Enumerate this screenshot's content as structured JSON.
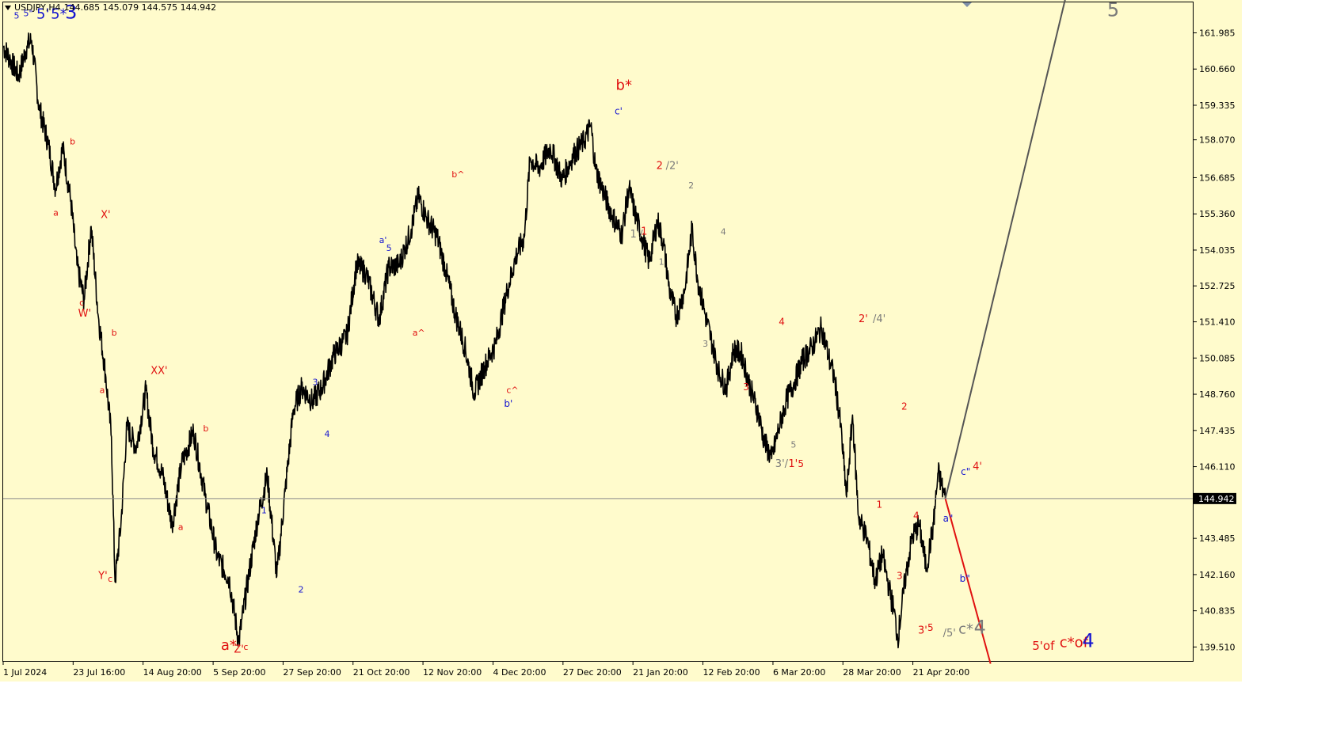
{
  "header": {
    "symbol_tf": "USDJPY,H4",
    "ohlc": "144.685 145.079 144.575 144.942"
  },
  "colors": {
    "background": "#fffbcc",
    "candles": "#000000",
    "red_label": "#e01010",
    "blue_label": "#1515d0",
    "gray_label": "#7a7a7a",
    "projection_up": "#555555",
    "projection_down": "#e01010"
  },
  "chart_data": {
    "type": "line",
    "symbol": "USDJPY",
    "timeframe": "H4",
    "last_price": 144.942,
    "ylim": [
      139.0,
      163.1
    ],
    "y_ticks": [
      161.985,
      160.66,
      159.335,
      158.07,
      156.685,
      155.36,
      154.035,
      152.725,
      151.41,
      150.085,
      148.76,
      147.435,
      146.11,
      144.942,
      143.485,
      142.16,
      140.835,
      139.51
    ],
    "x_ticks": [
      "1 Jul 2024",
      "23 Jul 16:00",
      "14 Aug 20:00",
      "5 Sep 20:00",
      "27 Sep 20:00",
      "21 Oct 20:00",
      "12 Nov 20:00",
      "4 Dec 20:00",
      "27 Dec 20:00",
      "21 Jan 20:00",
      "12 Feb 20:00",
      "6 Mar 20:00",
      "28 Mar 20:00",
      "21 Apr 20:00"
    ],
    "x_domain": [
      0,
      1000
    ],
    "x_tick_positions": [
      0,
      58.8,
      117.6,
      176.5,
      235.3,
      294.1,
      352.9,
      411.8,
      470.6,
      529.4,
      588.2,
      647.1,
      705.9,
      764.7
    ],
    "price_path": [
      [
        0,
        161.5
      ],
      [
        6,
        161.0
      ],
      [
        13,
        160.4
      ],
      [
        20,
        161.5
      ],
      [
        24,
        161.7
      ],
      [
        30,
        159.3
      ],
      [
        38,
        157.9
      ],
      [
        44,
        156.3
      ],
      [
        50,
        157.8
      ],
      [
        57,
        155.8
      ],
      [
        62,
        153.5
      ],
      [
        68,
        152.2
      ],
      [
        74,
        154.9
      ],
      [
        80,
        151.6
      ],
      [
        86,
        149.5
      ],
      [
        91,
        147.2
      ],
      [
        94,
        141.9
      ],
      [
        99,
        144.0
      ],
      [
        104,
        147.6
      ],
      [
        112,
        146.8
      ],
      [
        120,
        148.9
      ],
      [
        126,
        146.8
      ],
      [
        134,
        145.8
      ],
      [
        142,
        144.0
      ],
      [
        150,
        146.2
      ],
      [
        160,
        147.4
      ],
      [
        170,
        145.0
      ],
      [
        180,
        142.8
      ],
      [
        190,
        142.0
      ],
      [
        198,
        139.7
      ],
      [
        206,
        142.0
      ],
      [
        214,
        144.2
      ],
      [
        222,
        145.8
      ],
      [
        230,
        142.1
      ],
      [
        237,
        145.2
      ],
      [
        244,
        148.2
      ],
      [
        251,
        149.0
      ],
      [
        260,
        148.5
      ],
      [
        268,
        149.0
      ],
      [
        278,
        150.2
      ],
      [
        289,
        150.9
      ],
      [
        297,
        153.5
      ],
      [
        305,
        153.2
      ],
      [
        316,
        151.5
      ],
      [
        324,
        153.4
      ],
      [
        333,
        153.5
      ],
      [
        343,
        154.8
      ],
      [
        349,
        156.0
      ],
      [
        356,
        155.2
      ],
      [
        365,
        154.5
      ],
      [
        372,
        153.3
      ],
      [
        380,
        151.7
      ],
      [
        388,
        150.5
      ],
      [
        396,
        148.8
      ],
      [
        405,
        149.8
      ],
      [
        414,
        150.6
      ],
      [
        424,
        152.6
      ],
      [
        431,
        153.8
      ],
      [
        438,
        154.5
      ],
      [
        443,
        157.4
      ],
      [
        450,
        157.0
      ],
      [
        460,
        157.8
      ],
      [
        470,
        156.6
      ],
      [
        479,
        157.5
      ],
      [
        488,
        158.0
      ],
      [
        494,
        158.6
      ],
      [
        498,
        157.0
      ],
      [
        505,
        156.1
      ],
      [
        512,
        155.3
      ],
      [
        520,
        154.6
      ],
      [
        526,
        156.3
      ],
      [
        531,
        155.4
      ],
      [
        537,
        154.5
      ],
      [
        543,
        153.6
      ],
      [
        550,
        155.1
      ],
      [
        555,
        154.3
      ],
      [
        560,
        152.6
      ],
      [
        566,
        151.6
      ],
      [
        573,
        152.6
      ],
      [
        579,
        154.8
      ],
      [
        584,
        152.9
      ],
      [
        590,
        151.7
      ],
      [
        596,
        150.6
      ],
      [
        602,
        149.5
      ],
      [
        608,
        149.0
      ],
      [
        614,
        150.4
      ],
      [
        621,
        150.2
      ],
      [
        628,
        149.0
      ],
      [
        635,
        148.0
      ],
      [
        640,
        147.0
      ],
      [
        646,
        146.4
      ],
      [
        652,
        147.5
      ],
      [
        658,
        148.5
      ],
      [
        665,
        149.2
      ],
      [
        672,
        150.0
      ],
      [
        680,
        150.5
      ],
      [
        688,
        151.2
      ],
      [
        694,
        150.1
      ],
      [
        699,
        149.3
      ],
      [
        704,
        147.6
      ],
      [
        709,
        145.0
      ],
      [
        714,
        148.0
      ],
      [
        719,
        144.3
      ],
      [
        726,
        143.5
      ],
      [
        733,
        141.9
      ],
      [
        739,
        142.9
      ],
      [
        745,
        141.6
      ],
      [
        749,
        140.8
      ],
      [
        752,
        139.8
      ],
      [
        758,
        141.9
      ],
      [
        764,
        143.5
      ],
      [
        770,
        144.0
      ],
      [
        776,
        142.4
      ],
      [
        782,
        144.0
      ],
      [
        786,
        145.9
      ],
      [
        789,
        145.4
      ],
      [
        792,
        144.942
      ]
    ],
    "projections": [
      {
        "name": "up",
        "from": [
          792,
          144.942
        ],
        "to": [
          896,
          163.8
        ]
      },
      {
        "name": "down",
        "from": [
          792,
          144.942
        ],
        "to": [
          830,
          138.9
        ]
      }
    ]
  },
  "annotations": [
    {
      "text": "5",
      "c": "blue",
      "s": 11,
      "x": 9,
      "p": 162.5
    },
    {
      "text": "5\"",
      "c": "blue",
      "s": 11,
      "x": 17,
      "p": 162.6
    },
    {
      "text": "5'",
      "c": "blue",
      "s": 18,
      "x": 28,
      "p": 162.5
    },
    {
      "text": "5*",
      "c": "blue",
      "s": 18,
      "x": 40,
      "p": 162.5
    },
    {
      "text": "3",
      "c": "blue",
      "s": 24,
      "x": 52,
      "p": 162.5
    },
    {
      "text": "b",
      "c": "red",
      "s": 11,
      "x": 56,
      "p": 157.9
    },
    {
      "text": "a",
      "c": "red",
      "s": 11,
      "x": 42,
      "p": 155.3
    },
    {
      "text": "X'",
      "c": "red",
      "s": 13,
      "x": 82,
      "p": 155.2
    },
    {
      "text": "c",
      "c": "red",
      "s": 11,
      "x": 64,
      "p": 152.0
    },
    {
      "text": "W'",
      "c": "red",
      "s": 13,
      "x": 63,
      "p": 151.6
    },
    {
      "text": "b",
      "c": "red",
      "s": 11,
      "x": 91,
      "p": 150.9
    },
    {
      "text": "XX'",
      "c": "red",
      "s": 13,
      "x": 124,
      "p": 149.5
    },
    {
      "text": "a",
      "c": "red",
      "s": 11,
      "x": 81,
      "p": 148.8
    },
    {
      "text": "b",
      "c": "red",
      "s": 11,
      "x": 168,
      "p": 147.4
    },
    {
      "text": "a",
      "c": "red",
      "s": 11,
      "x": 147,
      "p": 143.8
    },
    {
      "text": "Y'",
      "c": "red",
      "s": 13,
      "x": 80,
      "p": 142.0
    },
    {
      "text": "c",
      "c": "red",
      "s": 11,
      "x": 88,
      "p": 141.9
    },
    {
      "text": "a*",
      "c": "red",
      "s": 18,
      "x": 183,
      "p": 139.4
    },
    {
      "text": "Z'",
      "c": "red",
      "s": 13,
      "x": 194,
      "p": 139.3
    },
    {
      "text": "c",
      "c": "red",
      "s": 11,
      "x": 202,
      "p": 139.4
    },
    {
      "text": "1",
      "c": "blue",
      "s": 11,
      "x": 217,
      "p": 144.4
    },
    {
      "text": "2",
      "c": "blue",
      "s": 11,
      "x": 248,
      "p": 141.5
    },
    {
      "text": "3",
      "c": "blue",
      "s": 11,
      "x": 260,
      "p": 149.1
    },
    {
      "text": "4",
      "c": "blue",
      "s": 11,
      "x": 270,
      "p": 147.2
    },
    {
      "text": "a'",
      "c": "blue",
      "s": 11,
      "x": 316,
      "p": 154.3
    },
    {
      "text": "5",
      "c": "blue",
      "s": 11,
      "x": 322,
      "p": 154.0
    },
    {
      "text": "a^",
      "c": "red",
      "s": 11,
      "x": 344,
      "p": 150.9
    },
    {
      "text": "b^",
      "c": "red",
      "s": 11,
      "x": 377,
      "p": 156.7
    },
    {
      "text": "c^",
      "c": "red",
      "s": 11,
      "x": 423,
      "p": 148.8
    },
    {
      "text": "b'",
      "c": "blue",
      "s": 12,
      "x": 421,
      "p": 148.3
    },
    {
      "text": "b*",
      "c": "red",
      "s": 18,
      "x": 515,
      "p": 159.9
    },
    {
      "text": "c'",
      "c": "blue",
      "s": 12,
      "x": 514,
      "p": 159.0
    },
    {
      "text": "2",
      "c": "red",
      "s": 13,
      "x": 549,
      "p": 157.0
    },
    {
      "text": "/2'",
      "c": "gray",
      "s": 13,
      "x": 557,
      "p": 157.0
    },
    {
      "text": "2",
      "c": "gray",
      "s": 11,
      "x": 576,
      "p": 156.3
    },
    {
      "text": "1'/",
      "c": "gray",
      "s": 13,
      "x": 527,
      "p": 154.5
    },
    {
      "text": "1",
      "c": "red",
      "s": 13,
      "x": 536,
      "p": 154.6
    },
    {
      "text": "4",
      "c": "gray",
      "s": 11,
      "x": 603,
      "p": 154.6
    },
    {
      "text": "1",
      "c": "gray",
      "s": 11,
      "x": 551,
      "p": 153.5
    },
    {
      "text": "3",
      "c": "gray",
      "s": 11,
      "x": 588,
      "p": 150.5
    },
    {
      "text": "4",
      "c": "red",
      "s": 12,
      "x": 652,
      "p": 151.3
    },
    {
      "text": "2'",
      "c": "red",
      "s": 13,
      "x": 719,
      "p": 151.4
    },
    {
      "text": "/4'",
      "c": "gray",
      "s": 13,
      "x": 731,
      "p": 151.4
    },
    {
      "text": "3",
      "c": "red",
      "s": 12,
      "x": 622,
      "p": 148.9
    },
    {
      "text": "5",
      "c": "gray",
      "s": 11,
      "x": 662,
      "p": 146.8
    },
    {
      "text": "3'/",
      "c": "gray",
      "s": 13,
      "x": 649,
      "p": 146.1
    },
    {
      "text": "1'",
      "c": "red",
      "s": 13,
      "x": 660,
      "p": 146.1
    },
    {
      "text": "5",
      "c": "red",
      "s": 12,
      "x": 668,
      "p": 146.1
    },
    {
      "text": "2",
      "c": "red",
      "s": 12,
      "x": 755,
      "p": 148.2
    },
    {
      "text": "4'",
      "c": "red",
      "s": 13,
      "x": 815,
      "p": 146.0
    },
    {
      "text": "c\"",
      "c": "blue",
      "s": 12,
      "x": 805,
      "p": 145.8
    },
    {
      "text": "1",
      "c": "red",
      "s": 12,
      "x": 734,
      "p": 144.6
    },
    {
      "text": "4",
      "c": "red",
      "s": 12,
      "x": 765,
      "p": 144.2
    },
    {
      "text": "a\"",
      "c": "blue",
      "s": 12,
      "x": 790,
      "p": 144.1
    },
    {
      "text": "3",
      "c": "red",
      "s": 12,
      "x": 751,
      "p": 142.0
    },
    {
      "text": "b\"",
      "c": "blue",
      "s": 12,
      "x": 804,
      "p": 141.9
    },
    {
      "text": "3'",
      "c": "red",
      "s": 13,
      "x": 769,
      "p": 140.0
    },
    {
      "text": "5",
      "c": "red",
      "s": 12,
      "x": 777,
      "p": 140.1
    },
    {
      "text": "/5'",
      "c": "gray",
      "s": 13,
      "x": 790,
      "p": 139.9
    },
    {
      "text": "c*",
      "c": "gray",
      "s": 18,
      "x": 803,
      "p": 140.0
    },
    {
      "text": "4",
      "c": "gray",
      "s": 24,
      "x": 816,
      "p": 140.0
    },
    {
      "text": "5'of",
      "c": "red",
      "s": 15,
      "x": 865,
      "p": 139.4
    },
    {
      "text": "c*of",
      "c": "red",
      "s": 18,
      "x": 888,
      "p": 139.5
    },
    {
      "text": "4",
      "c": "blue",
      "s": 24,
      "x": 907,
      "p": 139.5
    },
    {
      "text": "5",
      "c": "gray",
      "s": 24,
      "x": 928,
      "p": 162.6
    }
  ]
}
